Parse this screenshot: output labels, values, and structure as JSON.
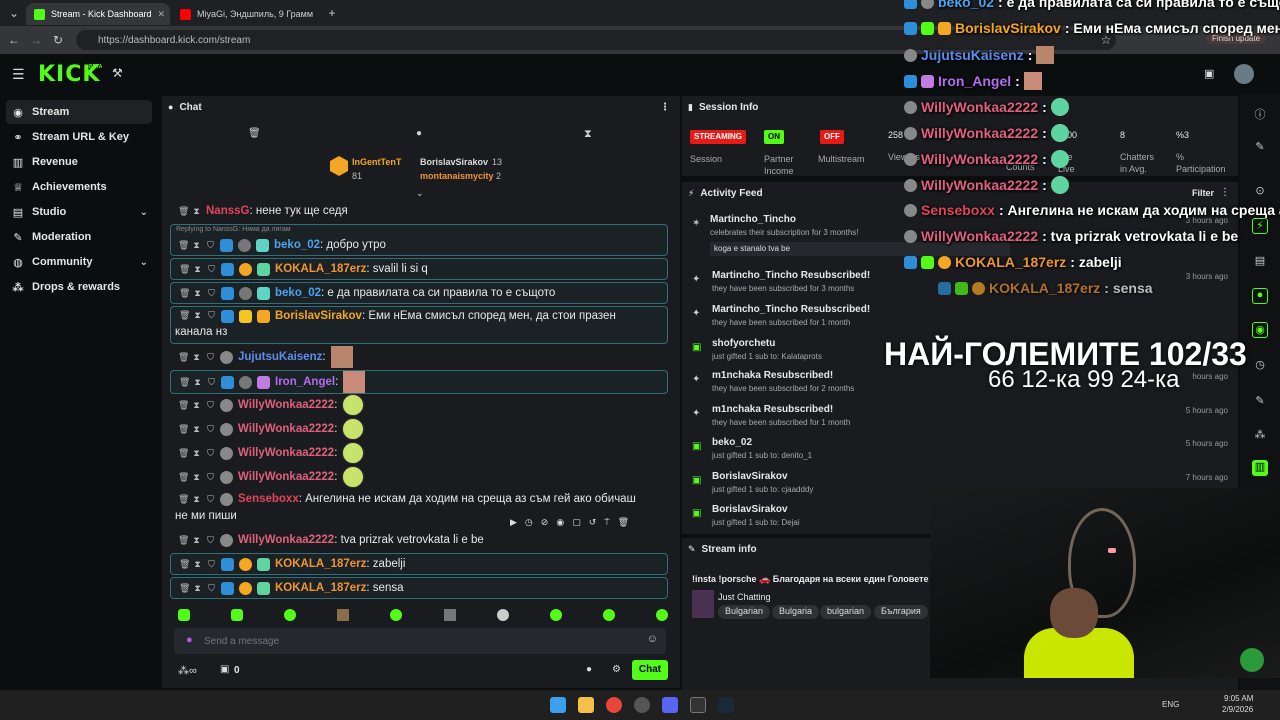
{
  "browser": {
    "tabs": [
      {
        "title": "Stream - Kick Dashboard"
      },
      {
        "title": "MiyaGi, Эндшпиль, 9 Грамм"
      }
    ],
    "url": "https://dashboard.kick.com/stream",
    "update_label": "Finish update"
  },
  "kick": {
    "logo": "KICK",
    "beta": "BETA"
  },
  "sidebar": {
    "items": [
      {
        "label": "Stream",
        "icon": "radio-icon"
      },
      {
        "label": "Stream URL & Key",
        "icon": "link-icon"
      },
      {
        "label": "Revenue",
        "icon": "chart-icon"
      },
      {
        "label": "Achievements",
        "icon": "trophy-icon"
      },
      {
        "label": "Studio",
        "icon": "studio-icon"
      },
      {
        "label": "Moderation",
        "icon": "wrench-icon"
      },
      {
        "label": "Community",
        "icon": "globe-icon"
      },
      {
        "label": "Drops & rewards",
        "icon": "drops-icon"
      }
    ]
  },
  "chat": {
    "title": "Chat",
    "leaders": {
      "first_name": "InGentTenT",
      "first_count": "81",
      "second_name": "BorislavSirakov",
      "second_count": "13",
      "third_name": "montanaismycity",
      "third_count": "2"
    },
    "reply_hint": "Replying to NanssG: Няма да лягам",
    "messages": [
      {
        "user": "NanssG",
        "text": ": нене тук ще седя",
        "color": "#e2445c"
      },
      {
        "user": "beko_02",
        "text": ": добро утро",
        "color": "#4aa3f0"
      },
      {
        "user": "KOKALA_187erz",
        "text": ": svalil li si q",
        "color": "#f0962f"
      },
      {
        "user": "beko_02",
        "text": ": е да правилата са си правила то е същото",
        "color": "#4aa3f0"
      },
      {
        "user": "BorislavSirakov",
        "text": ": Еми нЕма смисъл според мен, да стои празен",
        "text2": "канала нз",
        "color": "#f5a623"
      },
      {
        "user": "JujutsuKaisenz",
        "text": ":",
        "color": "#5b8def"
      },
      {
        "user": "Iron_Angel",
        "text": ":",
        "color": "#b46cf0"
      },
      {
        "user": "WillyWonkaa2222",
        "text": ":",
        "color": "#e0607e"
      },
      {
        "user": "WillyWonkaa2222",
        "text": ":",
        "color": "#e0607e"
      },
      {
        "user": "WillyWonkaa2222",
        "text": ":",
        "color": "#e0607e"
      },
      {
        "user": "WillyWonkaa2222",
        "text": ":",
        "color": "#e0607e"
      },
      {
        "user": "Senseboxx",
        "text": ": Ангелина не искам да ходим на среща аз съм гей ако обичаш",
        "text2": "не ми пиши",
        "color": "#e2445c"
      },
      {
        "user": "WillyWonkaa2222",
        "text": ": tva prizrak vetrovkata li e be",
        "color": "#e0607e"
      },
      {
        "user": "KOKALA_187erz",
        "text": ": zabelji",
        "color": "#f0962f"
      },
      {
        "user": "KOKALA_187erz",
        "text": ": sensa",
        "color": "#f0962f"
      }
    ],
    "input_placeholder": "Send a message",
    "viewer_count": "0",
    "send_label": "Chat"
  },
  "session": {
    "title": "Session Info",
    "streaming_label": "STREAMING",
    "on_label": "ON",
    "off_label": "OFF",
    "session_label": "Session",
    "partner_label": "Partner",
    "income_label": "Income",
    "multistream_label": "Multistream",
    "viewers_value": "258",
    "viewers_label": "Viewers",
    "counts_label": "Counts",
    "time_value": ":54:00",
    "time_label_part": "ime",
    "live_label": "Live",
    "chatters_value": "8",
    "chatters_label1": "Chatters",
    "chatters_label2": "in Avg.",
    "participation_value": "%3",
    "participation_label": "%",
    "participation_label2": "Participation"
  },
  "activity": {
    "title": "Activity Feed",
    "filter_label": "Filter",
    "items": [
      {
        "title": "Martincho_Tincho",
        "sub": "celebrates their subscription for 3 months!",
        "note": "koga e stanalo tva be",
        "ago": "3 hours ago"
      },
      {
        "title": "Martincho_Tincho Resubscribed!",
        "sub": "they have been subscribed for 3 months",
        "ago": "3 hours ago"
      },
      {
        "title": "Martincho_Tincho Resubscribed!",
        "sub": "they have been subscribed for 1 month",
        "ago": ""
      },
      {
        "title": "shofyorchetu",
        "sub": "just gifted 1 sub to: Kalataprots",
        "ago": ""
      },
      {
        "title": "m1nchaka Resubscribed!",
        "sub": "they have been subscribed for 2 months",
        "ago": "hours ago"
      },
      {
        "title": "m1nchaka Resubscribed!",
        "sub": "they have been subscribed for 1 month",
        "ago": "5 hours ago"
      },
      {
        "title": "beko_02",
        "sub": "just gifted 1 sub to: denito_1",
        "ago": "5 hours ago"
      },
      {
        "title": "BorislavSirakov",
        "sub": "just gifted 1 sub to: cjaadddy",
        "ago": "7 hours ago"
      },
      {
        "title": "BorislavSirakov",
        "sub": "just gifted 1 sub to: Dejai",
        "ago": ""
      }
    ]
  },
  "streaminfo": {
    "title": "Stream info",
    "stream_title": "!insta !porsche 🚗 Благодаря на всеки един Головете с",
    "category": "Just Chatting",
    "tags": [
      "Bulgarian",
      "Bulgaria",
      "bulgarian",
      "България"
    ]
  },
  "overlay": {
    "chat": [
      {
        "user": "beko_02",
        "text": ": е да правилата са си правила то е същото",
        "color": "#4aa3f0"
      },
      {
        "user": "BorislavSirakov",
        "text": ": Еми нЕма смисъл според мен, да",
        "color": "#f5a623"
      },
      {
        "user": "JujutsuKaisenz",
        "text": ":",
        "color": "#5b8def"
      },
      {
        "user": "Iron_Angel",
        "text": ":",
        "color": "#b46cf0"
      },
      {
        "user": "WillyWonkaa2222",
        "text": ":",
        "color": "#e0607e"
      },
      {
        "user": "WillyWonkaa2222",
        "text": ":",
        "color": "#e0607e"
      },
      {
        "user": "WillyWonkaa2222",
        "text": ":",
        "color": "#e0607e"
      },
      {
        "user": "WillyWonkaa2222",
        "text": ":",
        "color": "#e0607e"
      },
      {
        "user": "Senseboxx",
        "text": ": Ангелина не искам да ходим на среща аз",
        "color": "#e2445c"
      },
      {
        "user": "WillyWonkaa2222",
        "text": ": tva prizrak vetrovkata li e be",
        "color": "#e0607e"
      },
      {
        "user": "KOKALA_187erz",
        "text": ": zabelji",
        "color": "#f0962f"
      },
      {
        "user": "KOKALA_187erz",
        "text": ": sensa",
        "color": "#f0962f"
      }
    ],
    "big_title": "НАЙ-ГОЛЕМИТЕ 102/33",
    "big_sub": "66 12-ка 99 24-ка"
  },
  "taskbar": {
    "lang": "ENG",
    "time": "9:05 AM",
    "date": "2/9/2026"
  },
  "colors": {
    "brand": "#53fc18",
    "streaming": "#e91916",
    "on": "#53fc18",
    "off": "#e91916"
  }
}
